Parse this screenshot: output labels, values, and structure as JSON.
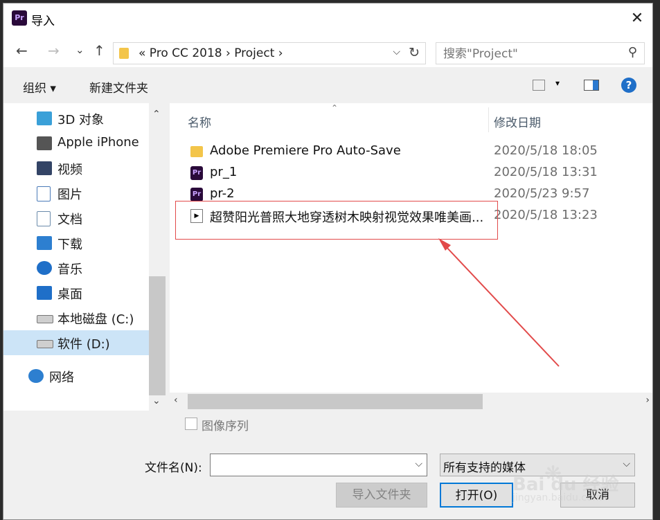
{
  "window": {
    "title": "导入",
    "app_icon_text": "Pr",
    "close_glyph": "✕"
  },
  "nav": {
    "back_glyph": "←",
    "forward_glyph": "→",
    "recent_glyph": "⌄",
    "up_glyph": "↑",
    "address": "«  Pro CC 2018  ›  Project  ›",
    "address_dropdown_glyph": "⌵",
    "refresh_glyph": "↻",
    "search_placeholder": "搜索\"Project\"",
    "search_glyph": "⚲"
  },
  "toolbar": {
    "organize": "组织 ▾",
    "new_folder": "新建文件夹",
    "view_dropdown_glyph": "▾",
    "help_glyph": "?"
  },
  "sidebar": {
    "items": [
      {
        "label": "3D 对象",
        "icon": "cube-icon",
        "color": "#3aa0d8"
      },
      {
        "label": "Apple iPhone",
        "icon": "phone-icon",
        "color": "#555555"
      },
      {
        "label": "视频",
        "icon": "video-icon",
        "color": "#334466"
      },
      {
        "label": "图片",
        "icon": "picture-icon",
        "color": "#4a7ab8"
      },
      {
        "label": "文档",
        "icon": "document-icon",
        "color": "#6a8aaa"
      },
      {
        "label": "下载",
        "icon": "download-icon",
        "color": "#2d7fd0"
      },
      {
        "label": "音乐",
        "icon": "music-icon",
        "color": "#1f6fc8"
      },
      {
        "label": "桌面",
        "icon": "desktop-icon",
        "color": "#1f6fc8"
      },
      {
        "label": "本地磁盘 (C:)",
        "icon": "drive-c-icon",
        "color": "#888888"
      },
      {
        "label": "软件 (D:)",
        "icon": "drive-d-icon",
        "color": "#888888"
      },
      {
        "label": "网络",
        "icon": "network-icon",
        "color": "#2d7fd0"
      }
    ],
    "scroll_up_glyph": "⌃",
    "scroll_down_glyph": "⌄"
  },
  "files": {
    "col_name": "名称",
    "col_date": "修改日期",
    "sort_glyph": "⌃",
    "rows": [
      {
        "name": "Adobe Premiere Pro Auto-Save",
        "date": "2020/5/18 18:05",
        "icon": "folder-icon"
      },
      {
        "name": "pr_1",
        "date": "2020/5/18 13:31",
        "icon": "premiere-project-icon"
      },
      {
        "name": "pr-2",
        "date": "2020/5/23 9:57",
        "icon": "premiere-project-icon"
      },
      {
        "name": "超赞阳光普照大地穿透树木映射视觉效果唯美画...",
        "date": "2020/5/18 13:23",
        "icon": "video-file-icon"
      }
    ],
    "hscroll_left_glyph": "‹",
    "hscroll_right_glyph": "›"
  },
  "footer": {
    "image_sequence_label": "图像序列",
    "filename_label": "文件名(N):",
    "filename_value": "",
    "filename_dropdown_glyph": "⌵",
    "filetype_value": "所有支持的媒体",
    "filetype_dropdown_glyph": "⌵",
    "import_folder": "导入文件夹",
    "open": "打开(O)",
    "cancel": "取消"
  },
  "watermark": {
    "text": "Bai du 经验",
    "sub": "jingyan.baidu.com"
  },
  "colors": {
    "highlight": "#e24a4a",
    "accent": "#0078d7"
  }
}
